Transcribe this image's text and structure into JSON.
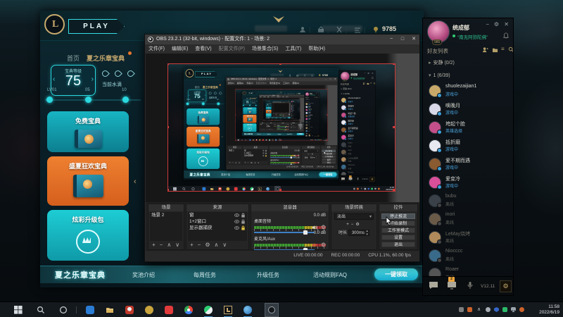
{
  "icons": {
    "minimize": "−",
    "maximize": "□",
    "close": "✕",
    "plus": "+",
    "minus": "−",
    "up": "∧",
    "down": "∨",
    "gear": "⚙",
    "caret": "▾",
    "stepper_up": "▴",
    "stepper_down": "▾",
    "prev": "‹",
    "next": "›",
    "collapse": "‹",
    "group_collapsed": "▸",
    "group_expanded": "▾",
    "list": "≡",
    "pipe": "|"
  },
  "lol": {
    "play_label": "PLAY",
    "currency": "9785",
    "tabs": [
      {
        "label": "首页"
      },
      {
        "label": "夏之乐章宝典"
      }
    ],
    "pass": {
      "level_label": "宝典等级",
      "level": "75",
      "tokens_label": "当前水滴",
      "milestones": [
        "LV01",
        "05",
        "10"
      ],
      "cards": [
        {
          "label": "免费宝典"
        },
        {
          "label": "盛夏狂欢宝典"
        },
        {
          "label": "炫彩升级包"
        }
      ]
    },
    "bottom_nav": {
      "title": "夏之乐章宝典",
      "items": [
        {
          "label": "奖池介绍"
        },
        {
          "label": "每周任务"
        },
        {
          "label": "升级任务"
        },
        {
          "label": "活动规则FAQ"
        }
      ],
      "claim_label": "一键领取"
    }
  },
  "obs": {
    "title": "OBS 23.2.1 (32-bit, windows) - 配置文件: 1 - 场景: 2",
    "menus": [
      {
        "label": "文件(F)"
      },
      {
        "label": "编辑(E)"
      },
      {
        "label": "查看(V)"
      },
      {
        "label": "配置文件(P)"
      },
      {
        "label": "场景集合(S)"
      },
      {
        "label": "工具(T)"
      },
      {
        "label": "帮助(H)"
      }
    ],
    "scenes": {
      "title": "场景",
      "items": [
        {
          "name": "场景 2"
        }
      ]
    },
    "sources": {
      "title": "来源",
      "items": [
        {
          "name": "窗"
        },
        {
          "name": "1+2窗口"
        },
        {
          "name": "显示器捕获"
        }
      ]
    },
    "mixer": {
      "title": "混音器",
      "channels": [
        {
          "name": "桌面音频",
          "db": "0.0 dB",
          "muted": false
        },
        {
          "name": "麦克风/Aux",
          "db": "0.0 dB",
          "muted": true
        }
      ]
    },
    "transitions": {
      "title": "场景转换",
      "selected": "淡出",
      "duration_label": "时长",
      "duration": "300ms"
    },
    "controls": {
      "title": "控件",
      "buttons": [
        {
          "label": "停止推流"
        },
        {
          "label": "开始录制"
        },
        {
          "label": "工作室模式"
        },
        {
          "label": "设置"
        },
        {
          "label": "退出"
        }
      ]
    },
    "status": {
      "live": "LIVE 00:00:00",
      "rec": "REC 00:00:00",
      "cpu": "CPU 1.1%, 60.00 fps"
    }
  },
  "friends": {
    "user": {
      "name": "统成郁",
      "status": "“南无阿弥陀佛”",
      "level": "985"
    },
    "panel_title": "好友列表",
    "groups": [
      {
        "label": "安静 (0/2)"
      },
      {
        "label": "1 (6/39)"
      }
    ],
    "entries": [
      {
        "name": "shuolezaijian1",
        "status": "游戏中"
      },
      {
        "name": "唤晚月",
        "status": "游戏中"
      },
      {
        "name": "垮起个脸",
        "status": "英雄选择"
      },
      {
        "name": "抵折磨",
        "status": "游戏中"
      },
      {
        "name": "爱不期而遇",
        "status": "游戏中"
      },
      {
        "name": "爱变冷",
        "status": "游戏中"
      },
      {
        "name": "bubu",
        "status": "离线"
      },
      {
        "name": "inori",
        "status": "离线"
      },
      {
        "name": "LeMay烧烤",
        "status": "离线"
      },
      {
        "name": "Niocccc",
        "status": "离线"
      },
      {
        "name": "Roaer",
        "status": "离线"
      }
    ],
    "footer": {
      "badge": "2",
      "version": "V12.11"
    }
  },
  "taskbar": {
    "clock": {
      "time": "11:58",
      "date": "2022/6/19"
    }
  }
}
